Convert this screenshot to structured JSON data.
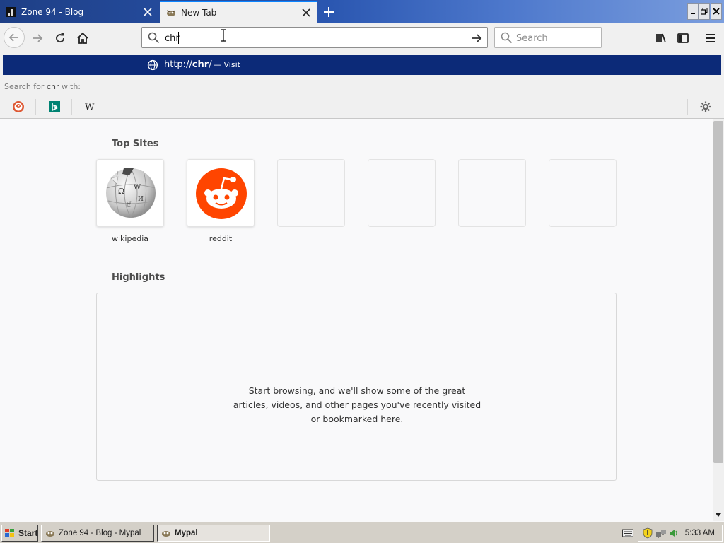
{
  "tabs": [
    {
      "title": "Zone 94 - Blog",
      "active": false
    },
    {
      "title": "New Tab",
      "active": true
    }
  ],
  "urlbar": {
    "value": "chr"
  },
  "searchbar": {
    "placeholder": "Search"
  },
  "autocomplete": {
    "url_prefix": "http://",
    "url_match": "chr",
    "url_suffix": "/",
    "action": "— Visit",
    "search_for_prefix": "Search for ",
    "search_for_term": "chr",
    "search_for_suffix": " with:"
  },
  "engines": [
    "duckduckgo-icon",
    "bing-icon",
    "wikipedia-icon"
  ],
  "top_sites": {
    "title": "Top Sites",
    "tiles": [
      {
        "label": "wikipedia"
      },
      {
        "label": "reddit"
      }
    ]
  },
  "highlights": {
    "title": "Highlights",
    "empty_message": "Start browsing, and we'll show some of the great articles, videos, and other pages you've recently visited or bookmarked here."
  },
  "taskbar": {
    "start": "Start",
    "tasks": [
      {
        "label": "Zone 94 - Blog - Mypal",
        "pressed": false
      },
      {
        "label": "Mypal",
        "pressed": true
      }
    ],
    "clock": "5:33 AM"
  },
  "colors": {
    "accent": "#0a84ff",
    "autocomplete_highlight": "#0c2a78",
    "reddit": "#ff4500"
  }
}
